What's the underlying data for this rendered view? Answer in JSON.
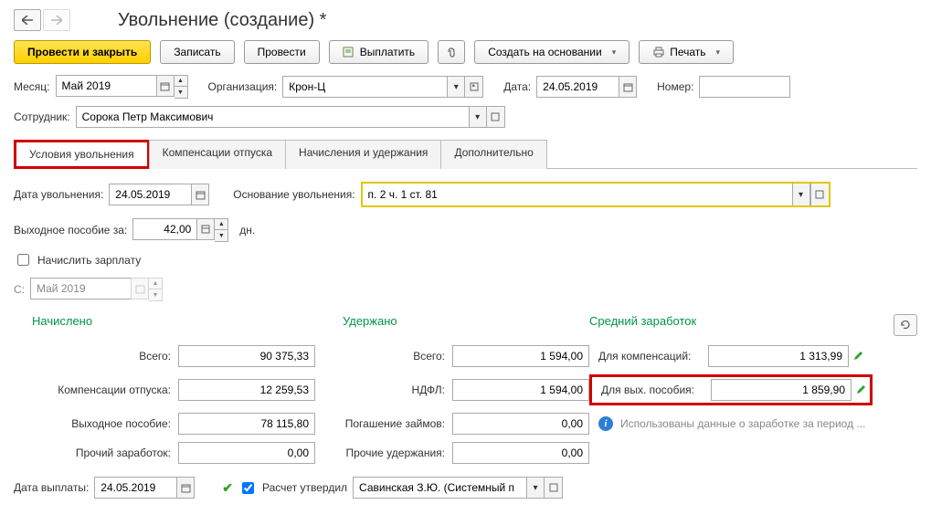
{
  "page_title": "Увольнение (создание) *",
  "toolbar": {
    "submit_close": "Провести и закрыть",
    "save": "Записать",
    "submit": "Провести",
    "pay": "Выплатить",
    "create_based": "Создать на основании",
    "print": "Печать"
  },
  "header": {
    "month_label": "Месяц:",
    "month_value": "Май 2019",
    "org_label": "Организация:",
    "org_value": "Крон-Ц",
    "date_label": "Дата:",
    "date_value": "24.05.2019",
    "number_label": "Номер:",
    "number_value": "",
    "employee_label": "Сотрудник:",
    "employee_value": "Сорока Петр Максимович"
  },
  "tabs": {
    "t1": "Условия увольнения",
    "t2": "Компенсации отпуска",
    "t3": "Начисления и удержания",
    "t4": "Дополнительно"
  },
  "conditions": {
    "date_label": "Дата увольнения:",
    "date_value": "24.05.2019",
    "basis_label": "Основание увольнения:",
    "basis_value": "п. 2 ч. 1 ст. 81",
    "severance_label": "Выходное пособие за:",
    "severance_value": "42,00",
    "severance_unit": "дн.",
    "accrue_salary_label": "Начислить зарплату",
    "from_label": "С:",
    "from_value": "Май 2019"
  },
  "sections": {
    "accrued": "Начислено",
    "withheld": "Удержано",
    "avg": "Средний заработок"
  },
  "accrued": {
    "total_label": "Всего:",
    "total_value": "90 375,33",
    "comp_label": "Компенсации отпуска:",
    "comp_value": "12 259,53",
    "sev_label": "Выходное пособие:",
    "sev_value": "78 115,80",
    "other_label": "Прочий заработок:",
    "other_value": "0,00"
  },
  "withheld": {
    "total_label": "Всего:",
    "total_value": "1 594,00",
    "ndfl_label": "НДФЛ:",
    "ndfl_value": "1 594,00",
    "loan_label": "Погашение займов:",
    "loan_value": "0,00",
    "other_label": "Прочие удержания:",
    "other_value": "0,00"
  },
  "avg": {
    "comp_label": "Для компенсаций:",
    "comp_value": "1 313,99",
    "sev_label": "Для вых. пособия:",
    "sev_value": "1 859,90",
    "info_text": "Использованы данные о заработке за период ..."
  },
  "footer": {
    "paydate_label": "Дата выплаты:",
    "paydate_value": "24.05.2019",
    "approved_label": "Расчет утвердил",
    "approver_value": "Савинская З.Ю. (Системный п"
  }
}
